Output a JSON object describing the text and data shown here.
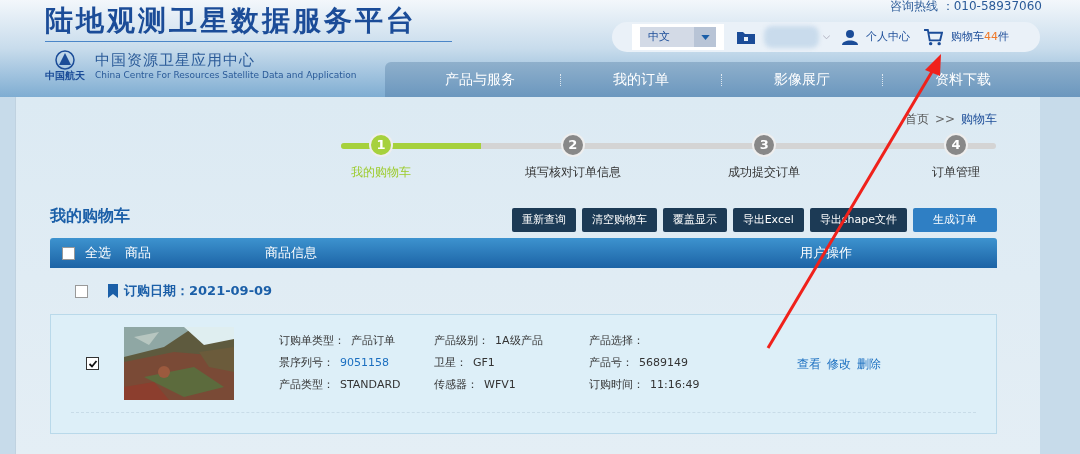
{
  "header": {
    "title": "陆地观测卫星数据服务平台",
    "logo_caption": "中国航天",
    "org_name": "中国资源卫星应用中心",
    "org_name_en": "China Centre For Resources Satellite Data and Application",
    "hotline": "咨询热线 ：010-58937060"
  },
  "toolbar": {
    "language": "中文",
    "personal_center": "个人中心",
    "cart_label": "购物车",
    "cart_count": "44",
    "cart_unit": "件"
  },
  "nav": [
    {
      "label": "产品与服务"
    },
    {
      "label": "我的订单"
    },
    {
      "label": "影像展厅"
    },
    {
      "label": "资料下载"
    }
  ],
  "breadcrumb": {
    "items": [
      "首页",
      "购物车"
    ],
    "separator": ">>"
  },
  "steps": [
    {
      "number": "1",
      "label": "我的购物车",
      "selected": true
    },
    {
      "number": "2",
      "label": "填写核对订单信息",
      "selected": false
    },
    {
      "number": "3",
      "label": "成功提交订单",
      "selected": false
    },
    {
      "number": "4",
      "label": "订单管理",
      "selected": false
    }
  ],
  "cart": {
    "title": "我的购物车",
    "buttons": [
      {
        "label": "重新查询",
        "kind": "dark"
      },
      {
        "label": "清空购物车",
        "kind": "dark"
      },
      {
        "label": "覆盖显示",
        "kind": "dark"
      },
      {
        "label": "导出Excel",
        "kind": "dark"
      },
      {
        "label": "导出shape文件",
        "kind": "dark"
      },
      {
        "label": "生成订单",
        "kind": "primary"
      }
    ],
    "select_all": {
      "label": "全选",
      "checked": false
    },
    "columns": [
      "商品",
      "商品信息",
      "用户操作"
    ],
    "groups": [
      {
        "date_label": "订购日期：2021-09-09",
        "checked": false,
        "items": [
          {
            "checked": true,
            "image": {
              "kind": "picture"
            },
            "field_columns": [
              [
                {
                  "label": "订购单类型：",
                  "value": "产品订单",
                  "link": false
                },
                {
                  "label": "景序列号：",
                  "value": "9051158",
                  "link": true
                },
                {
                  "label": "产品类型：",
                  "value": "STANDARD",
                  "link": false
                }
              ],
              [
                {
                  "label": "产品级别：",
                  "value": "1A级产品",
                  "link": false
                },
                {
                  "label": "卫星：",
                  "value": "GF1",
                  "link": false
                },
                {
                  "label": "传感器：",
                  "value": "WFV1",
                  "link": false
                }
              ],
              [
                {
                  "label": "产品选择："
                },
                {
                  "label": "产品号：",
                  "value": "5689149",
                  "link": false
                },
                {
                  "label": "订购时间：",
                  "value": "11:16:49",
                  "link": false
                }
              ]
            ],
            "actions": [
              "查看",
              "修改",
              "删除"
            ]
          }
        ]
      }
    ]
  }
}
